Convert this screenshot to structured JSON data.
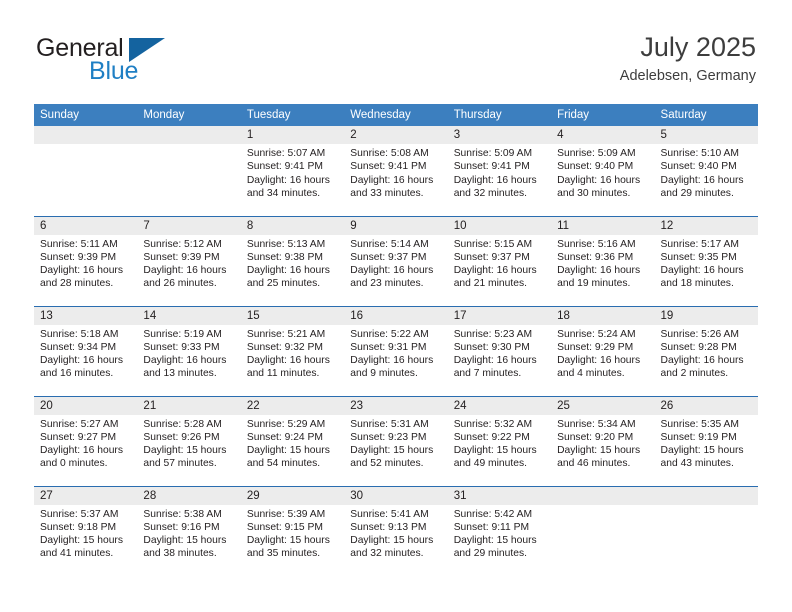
{
  "brand": {
    "word_one": "General",
    "word_two": "Blue",
    "mark": "triangle-logo"
  },
  "header": {
    "title": "July 2025",
    "subtitle": "Adelebsen, Germany"
  },
  "colors": {
    "header_blue": "#3c7fbf",
    "row_divider_blue": "#2a6db0",
    "daynum_band": "#ececec",
    "brand_blue": "#1f7fc4",
    "brand_mark": "#14639f",
    "text": "#231f20"
  },
  "calendar": {
    "weekday_headers": [
      "Sunday",
      "Monday",
      "Tuesday",
      "Wednesday",
      "Thursday",
      "Friday",
      "Saturday"
    ],
    "weeks": [
      [
        {
          "day": "",
          "blank": true,
          "sunrise": "",
          "sunset": "",
          "daylight_line1": "",
          "daylight_line2": ""
        },
        {
          "day": "",
          "blank": true,
          "sunrise": "",
          "sunset": "",
          "daylight_line1": "",
          "daylight_line2": ""
        },
        {
          "day": "1",
          "blank": false,
          "sunrise": "Sunrise: 5:07 AM",
          "sunset": "Sunset: 9:41 PM",
          "daylight_line1": "Daylight: 16 hours",
          "daylight_line2": "and 34 minutes."
        },
        {
          "day": "2",
          "blank": false,
          "sunrise": "Sunrise: 5:08 AM",
          "sunset": "Sunset: 9:41 PM",
          "daylight_line1": "Daylight: 16 hours",
          "daylight_line2": "and 33 minutes."
        },
        {
          "day": "3",
          "blank": false,
          "sunrise": "Sunrise: 5:09 AM",
          "sunset": "Sunset: 9:41 PM",
          "daylight_line1": "Daylight: 16 hours",
          "daylight_line2": "and 32 minutes."
        },
        {
          "day": "4",
          "blank": false,
          "sunrise": "Sunrise: 5:09 AM",
          "sunset": "Sunset: 9:40 PM",
          "daylight_line1": "Daylight: 16 hours",
          "daylight_line2": "and 30 minutes."
        },
        {
          "day": "5",
          "blank": false,
          "sunrise": "Sunrise: 5:10 AM",
          "sunset": "Sunset: 9:40 PM",
          "daylight_line1": "Daylight: 16 hours",
          "daylight_line2": "and 29 minutes."
        }
      ],
      [
        {
          "day": "6",
          "blank": false,
          "sunrise": "Sunrise: 5:11 AM",
          "sunset": "Sunset: 9:39 PM",
          "daylight_line1": "Daylight: 16 hours",
          "daylight_line2": "and 28 minutes."
        },
        {
          "day": "7",
          "blank": false,
          "sunrise": "Sunrise: 5:12 AM",
          "sunset": "Sunset: 9:39 PM",
          "daylight_line1": "Daylight: 16 hours",
          "daylight_line2": "and 26 minutes."
        },
        {
          "day": "8",
          "blank": false,
          "sunrise": "Sunrise: 5:13 AM",
          "sunset": "Sunset: 9:38 PM",
          "daylight_line1": "Daylight: 16 hours",
          "daylight_line2": "and 25 minutes."
        },
        {
          "day": "9",
          "blank": false,
          "sunrise": "Sunrise: 5:14 AM",
          "sunset": "Sunset: 9:37 PM",
          "daylight_line1": "Daylight: 16 hours",
          "daylight_line2": "and 23 minutes."
        },
        {
          "day": "10",
          "blank": false,
          "sunrise": "Sunrise: 5:15 AM",
          "sunset": "Sunset: 9:37 PM",
          "daylight_line1": "Daylight: 16 hours",
          "daylight_line2": "and 21 minutes."
        },
        {
          "day": "11",
          "blank": false,
          "sunrise": "Sunrise: 5:16 AM",
          "sunset": "Sunset: 9:36 PM",
          "daylight_line1": "Daylight: 16 hours",
          "daylight_line2": "and 19 minutes."
        },
        {
          "day": "12",
          "blank": false,
          "sunrise": "Sunrise: 5:17 AM",
          "sunset": "Sunset: 9:35 PM",
          "daylight_line1": "Daylight: 16 hours",
          "daylight_line2": "and 18 minutes."
        }
      ],
      [
        {
          "day": "13",
          "blank": false,
          "sunrise": "Sunrise: 5:18 AM",
          "sunset": "Sunset: 9:34 PM",
          "daylight_line1": "Daylight: 16 hours",
          "daylight_line2": "and 16 minutes."
        },
        {
          "day": "14",
          "blank": false,
          "sunrise": "Sunrise: 5:19 AM",
          "sunset": "Sunset: 9:33 PM",
          "daylight_line1": "Daylight: 16 hours",
          "daylight_line2": "and 13 minutes."
        },
        {
          "day": "15",
          "blank": false,
          "sunrise": "Sunrise: 5:21 AM",
          "sunset": "Sunset: 9:32 PM",
          "daylight_line1": "Daylight: 16 hours",
          "daylight_line2": "and 11 minutes."
        },
        {
          "day": "16",
          "blank": false,
          "sunrise": "Sunrise: 5:22 AM",
          "sunset": "Sunset: 9:31 PM",
          "daylight_line1": "Daylight: 16 hours",
          "daylight_line2": "and 9 minutes."
        },
        {
          "day": "17",
          "blank": false,
          "sunrise": "Sunrise: 5:23 AM",
          "sunset": "Sunset: 9:30 PM",
          "daylight_line1": "Daylight: 16 hours",
          "daylight_line2": "and 7 minutes."
        },
        {
          "day": "18",
          "blank": false,
          "sunrise": "Sunrise: 5:24 AM",
          "sunset": "Sunset: 9:29 PM",
          "daylight_line1": "Daylight: 16 hours",
          "daylight_line2": "and 4 minutes."
        },
        {
          "day": "19",
          "blank": false,
          "sunrise": "Sunrise: 5:26 AM",
          "sunset": "Sunset: 9:28 PM",
          "daylight_line1": "Daylight: 16 hours",
          "daylight_line2": "and 2 minutes."
        }
      ],
      [
        {
          "day": "20",
          "blank": false,
          "sunrise": "Sunrise: 5:27 AM",
          "sunset": "Sunset: 9:27 PM",
          "daylight_line1": "Daylight: 16 hours",
          "daylight_line2": "and 0 minutes."
        },
        {
          "day": "21",
          "blank": false,
          "sunrise": "Sunrise: 5:28 AM",
          "sunset": "Sunset: 9:26 PM",
          "daylight_line1": "Daylight: 15 hours",
          "daylight_line2": "and 57 minutes."
        },
        {
          "day": "22",
          "blank": false,
          "sunrise": "Sunrise: 5:29 AM",
          "sunset": "Sunset: 9:24 PM",
          "daylight_line1": "Daylight: 15 hours",
          "daylight_line2": "and 54 minutes."
        },
        {
          "day": "23",
          "blank": false,
          "sunrise": "Sunrise: 5:31 AM",
          "sunset": "Sunset: 9:23 PM",
          "daylight_line1": "Daylight: 15 hours",
          "daylight_line2": "and 52 minutes."
        },
        {
          "day": "24",
          "blank": false,
          "sunrise": "Sunrise: 5:32 AM",
          "sunset": "Sunset: 9:22 PM",
          "daylight_line1": "Daylight: 15 hours",
          "daylight_line2": "and 49 minutes."
        },
        {
          "day": "25",
          "blank": false,
          "sunrise": "Sunrise: 5:34 AM",
          "sunset": "Sunset: 9:20 PM",
          "daylight_line1": "Daylight: 15 hours",
          "daylight_line2": "and 46 minutes."
        },
        {
          "day": "26",
          "blank": false,
          "sunrise": "Sunrise: 5:35 AM",
          "sunset": "Sunset: 9:19 PM",
          "daylight_line1": "Daylight: 15 hours",
          "daylight_line2": "and 43 minutes."
        }
      ],
      [
        {
          "day": "27",
          "blank": false,
          "sunrise": "Sunrise: 5:37 AM",
          "sunset": "Sunset: 9:18 PM",
          "daylight_line1": "Daylight: 15 hours",
          "daylight_line2": "and 41 minutes."
        },
        {
          "day": "28",
          "blank": false,
          "sunrise": "Sunrise: 5:38 AM",
          "sunset": "Sunset: 9:16 PM",
          "daylight_line1": "Daylight: 15 hours",
          "daylight_line2": "and 38 minutes."
        },
        {
          "day": "29",
          "blank": false,
          "sunrise": "Sunrise: 5:39 AM",
          "sunset": "Sunset: 9:15 PM",
          "daylight_line1": "Daylight: 15 hours",
          "daylight_line2": "and 35 minutes."
        },
        {
          "day": "30",
          "blank": false,
          "sunrise": "Sunrise: 5:41 AM",
          "sunset": "Sunset: 9:13 PM",
          "daylight_line1": "Daylight: 15 hours",
          "daylight_line2": "and 32 minutes."
        },
        {
          "day": "31",
          "blank": false,
          "sunrise": "Sunrise: 5:42 AM",
          "sunset": "Sunset: 9:11 PM",
          "daylight_line1": "Daylight: 15 hours",
          "daylight_line2": "and 29 minutes."
        },
        {
          "day": "",
          "blank": true,
          "sunrise": "",
          "sunset": "",
          "daylight_line1": "",
          "daylight_line2": ""
        },
        {
          "day": "",
          "blank": true,
          "sunrise": "",
          "sunset": "",
          "daylight_line1": "",
          "daylight_line2": ""
        }
      ]
    ]
  }
}
